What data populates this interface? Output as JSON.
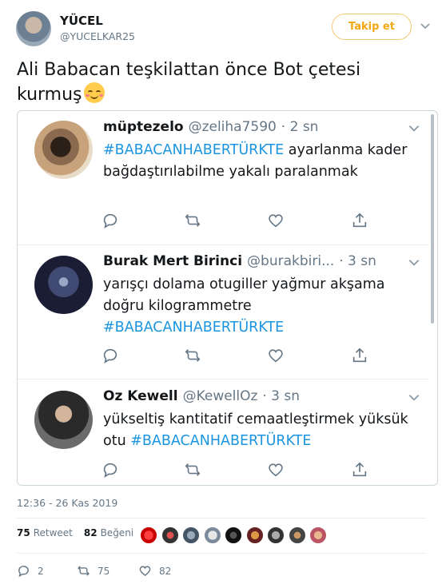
{
  "author": {
    "name": "YÜCEL",
    "handle": "@YUCELKAR25",
    "follow_label": "Takip et"
  },
  "tweet": {
    "text": "Ali Babacan teşkilattan önce Bot çetesi kurmuş",
    "emoji": "smiling-face-with-blush"
  },
  "quoted_tweets": [
    {
      "name": "müptezelo",
      "handle": "@zeliha7590",
      "time": "· 2 sn",
      "hashtag": "#BABACANHABERTÜRKTE",
      "text_after": " ayarlanma kader bağdaştırılabilme yakalı paralanmak"
    },
    {
      "name": "Burak Mert Birinci",
      "handle": "@burakbiri...",
      "time": "· 3 sn",
      "text_before": "yarışçı dolama otugiller yağmur akşama doğru kilogrammetre ",
      "hashtag": "#BABACANHABERTÜRKTE"
    },
    {
      "name": "Oz Kewell",
      "handle": "@KewellOz",
      "time": "· 3 sn",
      "text_before": "yükseltiş kantitatif cemaatleştirmek yüksük otu ",
      "hashtag": "#BABACANHABERTÜRKTE"
    }
  ],
  "timestamp": "12:36 - 26 Kas 2019",
  "stats": {
    "retweet_count": "75",
    "retweet_label": "Retweet",
    "like_count": "82",
    "like_label": "Beğeni"
  },
  "actions": {
    "reply_count": "2",
    "retweet_count": "75",
    "like_count": "82"
  },
  "colors": {
    "accent": "#1b95e0",
    "follow_border": "#f3c86f",
    "follow_text": "#f3a712",
    "secondary_text": "#657786"
  }
}
